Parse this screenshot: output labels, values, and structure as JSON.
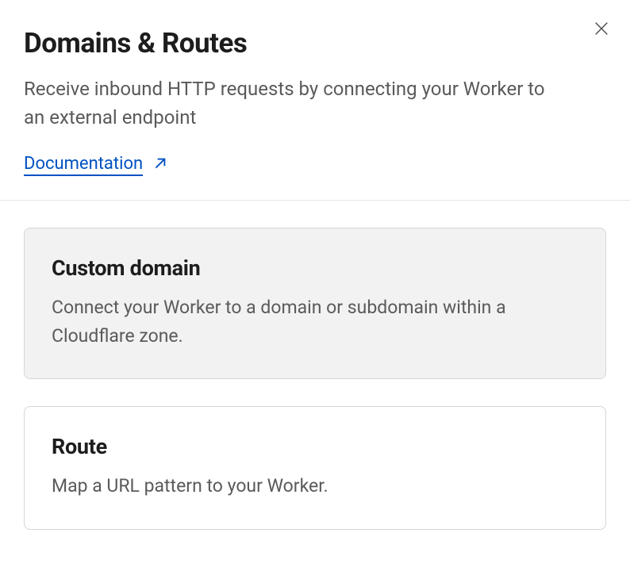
{
  "header": {
    "title": "Domains & Routes",
    "subtitle": "Receive inbound HTTP requests by connecting your Worker to an external endpoint",
    "doc_label": "Documentation"
  },
  "options": [
    {
      "title": "Custom domain",
      "desc": "Connect your Worker to a domain or subdomain within a Cloudflare zone.",
      "selected": true
    },
    {
      "title": "Route",
      "desc": "Map a URL pattern to your Worker.",
      "selected": false
    }
  ]
}
